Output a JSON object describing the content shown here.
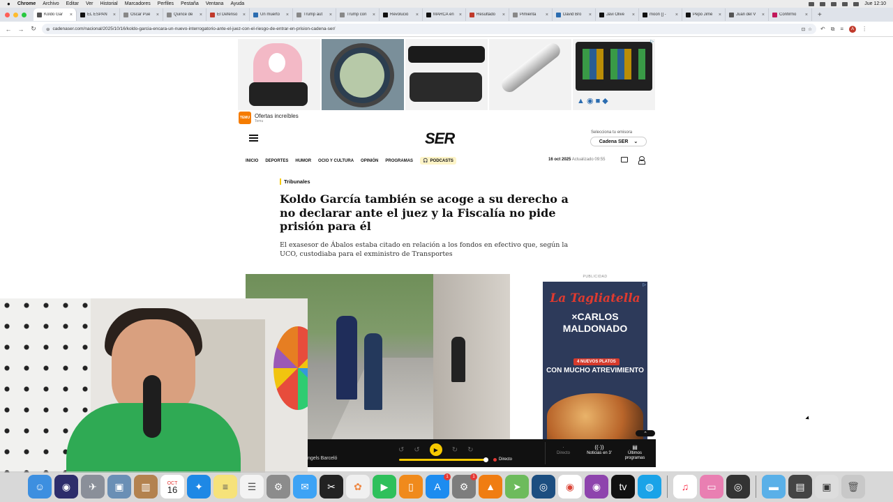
{
  "menubar": {
    "app": "Chrome",
    "items": [
      "Archivo",
      "Editar",
      "Ver",
      "Historial",
      "Marcadores",
      "Perfiles",
      "Pestaña",
      "Ventana",
      "Ayuda"
    ],
    "clock": "Jue 12:10"
  },
  "tabs": [
    {
      "title": "Koldo Gar",
      "active": true,
      "color": "#555555"
    },
    {
      "title": "EL ESPAÑ",
      "active": false,
      "color": "#111111"
    },
    {
      "title": "Óscar Pue",
      "active": false,
      "color": "#888888"
    },
    {
      "title": "Quince de",
      "active": false,
      "color": "#888888"
    },
    {
      "title": "El Defenso",
      "active": false,
      "color": "#c0392b"
    },
    {
      "title": "Un muerto",
      "active": false,
      "color": "#2b6cb0"
    },
    {
      "title": "Trump aut",
      "active": false,
      "color": "#888888"
    },
    {
      "title": "Trump con",
      "active": false,
      "color": "#888888"
    },
    {
      "title": "Revolució",
      "active": false,
      "color": "#111111"
    },
    {
      "title": "MARCA en",
      "active": false,
      "color": "#111111"
    },
    {
      "title": "Resultado",
      "active": false,
      "color": "#c0392b"
    },
    {
      "title": "Pimienta",
      "active": false,
      "color": "#888888"
    },
    {
      "title": "David Bro",
      "active": false,
      "color": "#2b6cb0"
    },
    {
      "title": "Javi Olive",
      "active": false,
      "color": "#111111"
    },
    {
      "title": "moon [] -",
      "active": false,
      "color": "#111111"
    },
    {
      "title": "Pepo Jimé",
      "active": false,
      "color": "#111111"
    },
    {
      "title": "Juan del V",
      "active": false,
      "color": "#555555"
    },
    {
      "title": "Confirmo",
      "active": false,
      "color": "#c2185b"
    }
  ],
  "address": {
    "url": "cadenaser.com/nacional/2025/10/16/koldo-garcia-encara-un-nuevo-interrogatorio-ante-el-juez-con-el-riesgo-de-entrar-en-prision-cadena-ser/"
  },
  "ad": {
    "source_logo": "TEMU",
    "source_title": "Ofertas increíbles",
    "source_sub": "Temu"
  },
  "header": {
    "logo": "SER",
    "station_label": "Selecciona tu emisora",
    "station": "Cadena SER"
  },
  "nav": {
    "items": [
      "INICIO",
      "DEPORTES",
      "HUMOR",
      "OCIO Y CULTURA",
      "OPINIÓN",
      "PROGRAMAS"
    ],
    "podcasts": "PODCASTS",
    "date": "16 oct 2025",
    "updated": "Actualizado 09:55"
  },
  "article": {
    "section": "Tribunales",
    "headline": "Koldo García también se acoge a su derecho a no declarar ante el juez y la Fiscalía no pide prisión para él",
    "subhead": "El exasesor de Ábalos estaba citado en relación a los fondos en efectivo que, según la UCO, custodiaba para el exministro de Transportes"
  },
  "sidead": {
    "label": "PUBLICIDAD",
    "brand": "La Tagliatella",
    "collab": "×CARLOS MALDONADO",
    "badge": "4 NUEVOS PLATOS",
    "promo": "CON MUCHO ATREVIMIENTO"
  },
  "player": {
    "presenter": "ngels Barceló",
    "live": "Directo",
    "opt_directo": "Directo",
    "opt_noticias": "Noticias en 3'",
    "opt_ultimos": "Últimos programas"
  },
  "dock": {
    "calendar_month": "OCT",
    "calendar_day": "16",
    "appstore_badge": "1",
    "settings_badge": "1"
  }
}
